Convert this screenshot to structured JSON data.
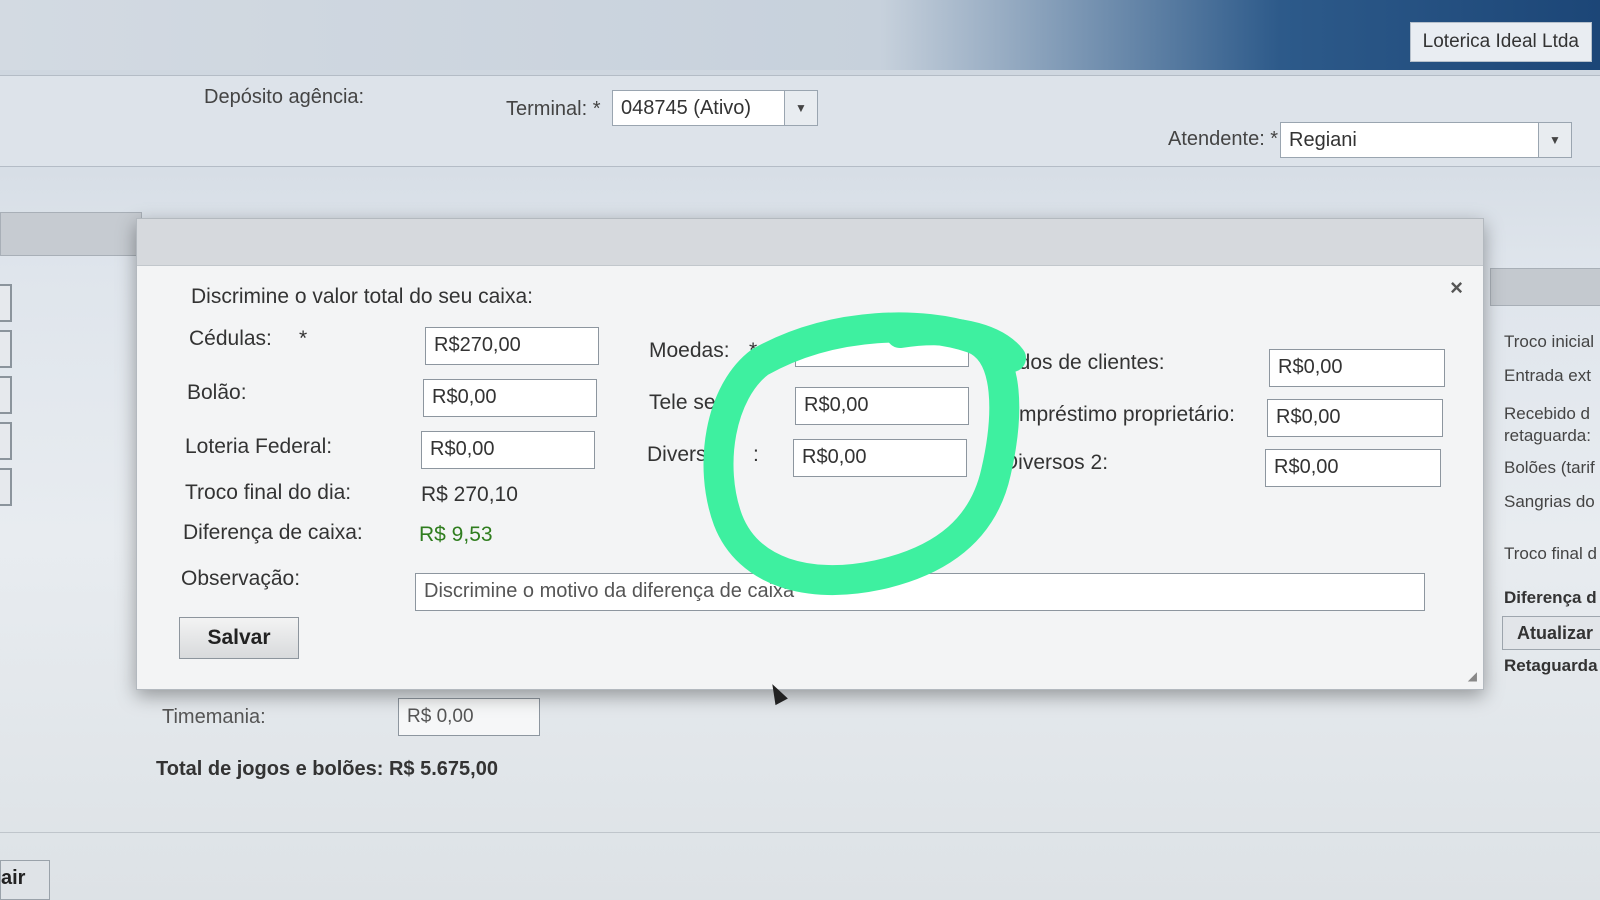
{
  "header": {
    "company": "Loterica Ideal Ltda",
    "deposito_label": "Depósito agência:",
    "terminal_label": "Terminal: *",
    "terminal_value": "048745 (Ativo)",
    "atendente_label": "Atendente: *",
    "atendente_value": "Regiani"
  },
  "right_panel": {
    "items": [
      "Troco inicial",
      "Entrada ext",
      "Recebido d",
      "retaguarda:",
      "Bolões (tarif",
      "Sangrias do",
      "Troco final d",
      "Diferença d"
    ],
    "button": "Atualizar",
    "retaguarda": "Retaguarda"
  },
  "dialog": {
    "title": "Discrimine o valor total do seu caixa:",
    "close": "×",
    "cedulas_label": "Cédulas:",
    "required_mark": "*",
    "cedulas_value": "R$270,00",
    "bolao_label": "Bolão:",
    "bolao_value": "R$0,00",
    "loteria_label": "Loteria Federal:",
    "loteria_value": "R$0,00",
    "moedas_label": "Moedas:",
    "moedas_mark": "*",
    "tele_label": "Tele ser",
    "tele_value": "R$0,00",
    "diversos_label": "Diverso",
    "diversos_colon": ":",
    "diversos_value": "R$0,00",
    "clientes_label": "ados de clientes:",
    "clientes_value": "R$0,00",
    "emprestimo_label": "Empréstimo proprietário:",
    "emprestimo_value": "R$0,00",
    "diversos2_label": "Diversos 2:",
    "diversos2_value": "R$0,00",
    "troco_label": "Troco final do dia:",
    "troco_value": "R$ 270,10",
    "diferenca_label": "Diferença de caixa:",
    "diferenca_value": "R$ 9,53",
    "observacao_label": "Observação:",
    "observacao_placeholder": "Discrimine o motivo da diferença de caixa",
    "save": "Salvar"
  },
  "below": {
    "timemania_label": "Timemania:",
    "timemania_value": "R$ 0,00",
    "total": "Total de jogos e bolões: R$ 5.675,00"
  },
  "footer": {
    "sair": "air"
  },
  "colors": {
    "annotation": "#3ef0a0",
    "positive": "#2f7d1e"
  }
}
